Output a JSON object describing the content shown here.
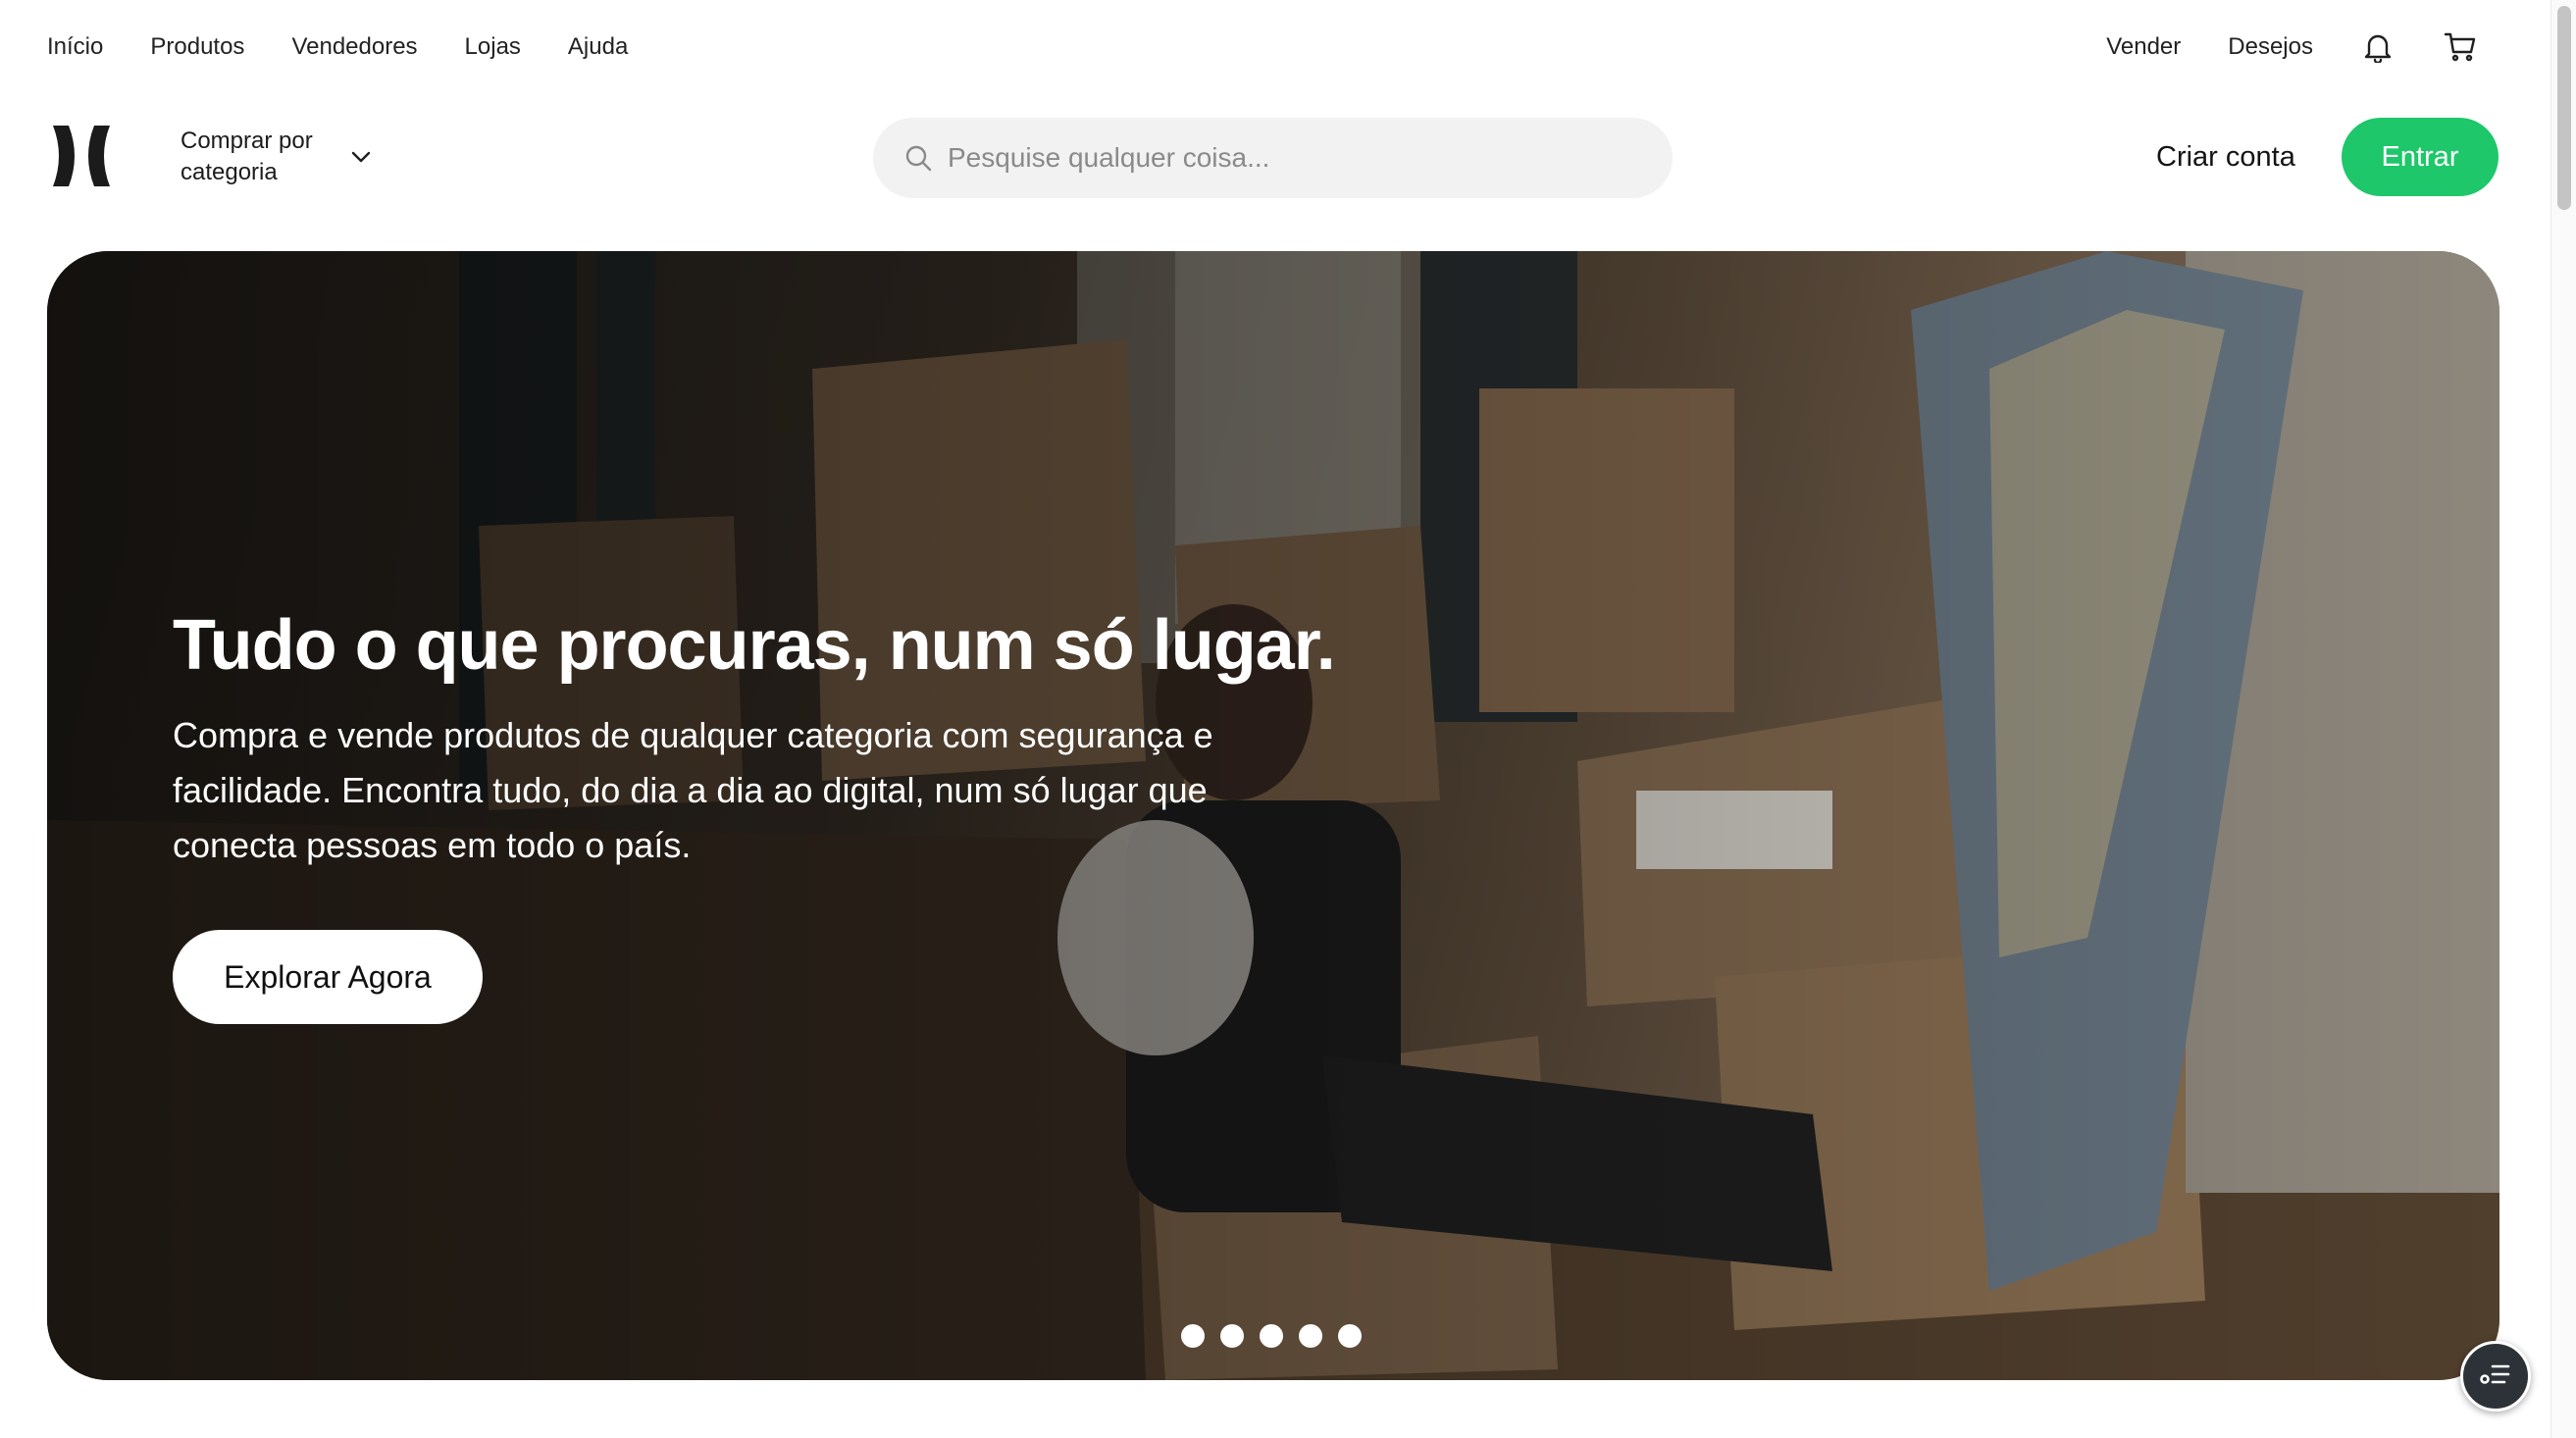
{
  "topnav": {
    "left": [
      "Início",
      "Produtos",
      "Vendedores",
      "Lojas",
      "Ajuda"
    ],
    "right": [
      "Vender",
      "Desejos"
    ],
    "icons": [
      "bell-icon",
      "cart-icon"
    ]
  },
  "header": {
    "category_label": "Comprar por categoria",
    "search_placeholder": "Pesquise qualquer coisa...",
    "signup_label": "Criar conta",
    "login_label": "Entrar",
    "accent_color": "#1ec76a"
  },
  "hero": {
    "title": "Tudo o que procuras, num só lugar.",
    "subtitle": "Compra e vende produtos de qualquer categoria com segurança e facilidade. Encontra tudo, do dia a dia ao digital, num só lugar que conecta pessoas em todo o país.",
    "cta_label": "Explorar Agora",
    "slide_count": 5
  }
}
